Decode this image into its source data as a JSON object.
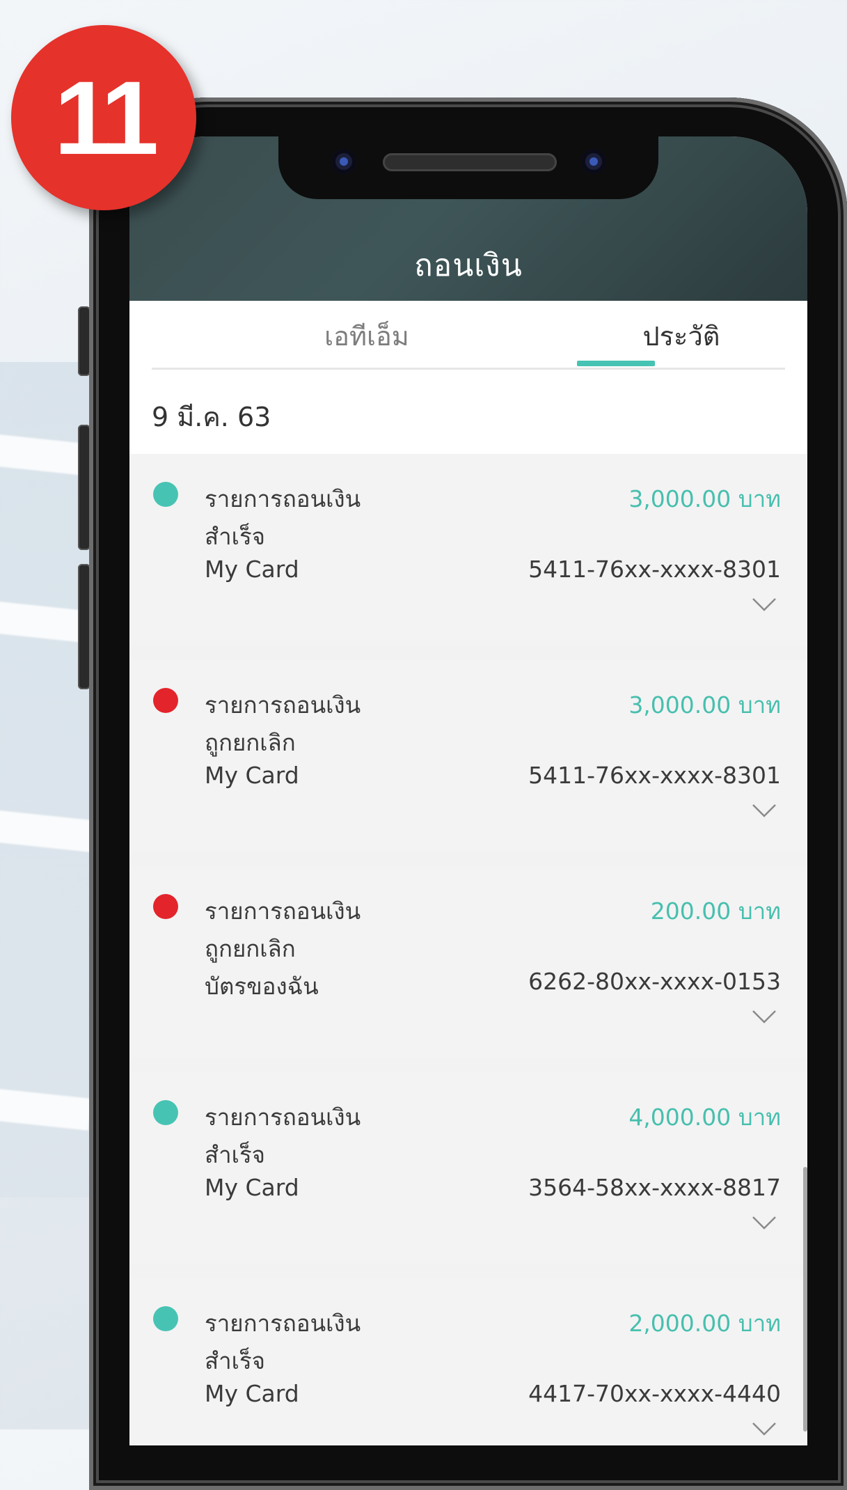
{
  "badge": {
    "number": "11",
    "color": "#e5322b"
  },
  "header": {
    "title": "ถอนเงิน"
  },
  "tabs": [
    {
      "label": "เอทีเอ็ม",
      "active": false
    },
    {
      "label": "ประวัติ",
      "active": true
    }
  ],
  "colors": {
    "accent": "#47c3b3",
    "success": "#47c3b3",
    "cancelled": "#e3242b",
    "header_bg": "#3f5658"
  },
  "history": {
    "date": "9 มี.ค. 63",
    "items": [
      {
        "title": "รายการถอนเงิน",
        "status": "สำเร็จ",
        "status_type": "success",
        "card_name": "My Card",
        "amount": "3,000.00 บาท",
        "card_number": "5411-76xx-xxxx-8301",
        "expand_icon": "chevron-down-icon"
      },
      {
        "title": "รายการถอนเงิน",
        "status": "ถูกยกเลิก",
        "status_type": "cancelled",
        "card_name": "My Card",
        "amount": "3,000.00 บาท",
        "card_number": "5411-76xx-xxxx-8301",
        "expand_icon": "chevron-down-icon"
      },
      {
        "title": "รายการถอนเงิน",
        "status": "ถูกยกเลิก",
        "status_type": "cancelled",
        "card_name": "บัตรของฉัน",
        "amount": "200.00 บาท",
        "card_number": "6262-80xx-xxxx-0153",
        "expand_icon": "chevron-down-icon"
      },
      {
        "title": "รายการถอนเงิน",
        "status": "สำเร็จ",
        "status_type": "success",
        "card_name": "My Card",
        "amount": "4,000.00 บาท",
        "card_number": "3564-58xx-xxxx-8817",
        "expand_icon": "chevron-down-icon"
      },
      {
        "title": "รายการถอนเงิน",
        "status": "สำเร็จ",
        "status_type": "success",
        "card_name": "My Card",
        "amount": "2,000.00 บาท",
        "card_number": "4417-70xx-xxxx-4440",
        "expand_icon": "chevron-down-icon"
      }
    ]
  }
}
